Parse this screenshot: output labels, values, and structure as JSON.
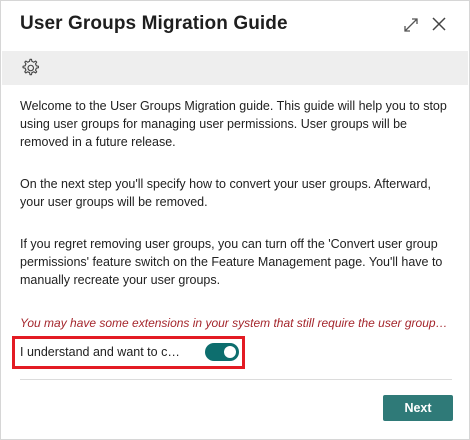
{
  "dialog": {
    "title": "User Groups Migration Guide",
    "expand_icon": "expand-icon",
    "close_icon": "close-icon"
  },
  "toolbar": {
    "settings_icon": "gear-icon"
  },
  "content": {
    "paragraphs": [
      "Welcome to the User Groups Migration guide. This guide will help you to stop using user groups for managing user permissions. User groups will be removed in a future release.",
      "On the next step you'll specify how to convert your user groups. Afterward, your user groups will be removed.",
      "If you regret removing user groups, you can turn off the 'Convert user group permissions' feature switch on the Feature Management page. You'll have to manually recreate your user groups."
    ],
    "warning": "You may have some extensions in your system that still require the user groups functi..."
  },
  "consent": {
    "label": "I understand and want to conti...",
    "checked": true
  },
  "footer": {
    "next_label": "Next"
  },
  "colors": {
    "accent": "#2f7a78",
    "toggle_on": "#0d6e6e",
    "warning_text": "#a4262c",
    "highlight_border": "#e31b23",
    "toolbar_bg": "#eeeeee"
  }
}
